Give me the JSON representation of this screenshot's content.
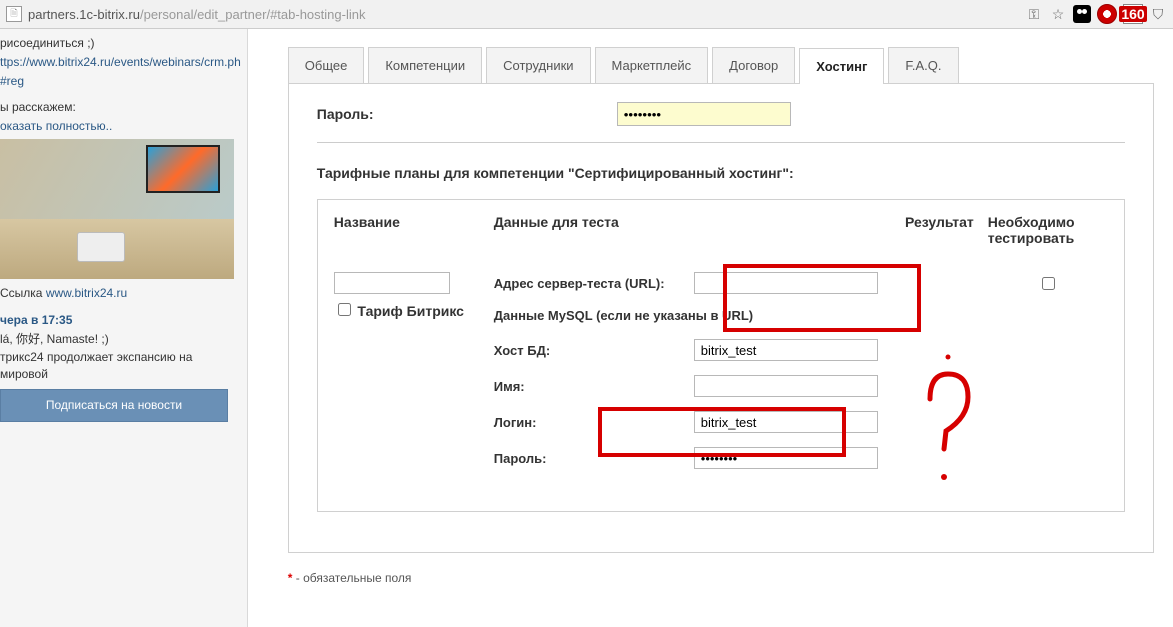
{
  "url": {
    "host": "partners.1c-bitrix.ru",
    "path": "/personal/edit_partner/#tab-hosting-link"
  },
  "ext_badge": "160",
  "sidebar": {
    "line0": "рисоединиться ;)",
    "link1": "ttps://www.bitrix24.ru/events/webinars/crm.ph",
    "line2": "#reg",
    "line3": "ы расскажем:",
    "line4": "оказать полностью..",
    "link_lbl": "Ссылка",
    "link_url": "www.bitrix24.ru",
    "time": "чера в 17:35",
    "greet": "lá, 你好, Namaste! ;)",
    "expand": "трикс24 продолжает экспансию на мировой",
    "subscribe": "Подписаться на новости"
  },
  "tabs": [
    "Общее",
    "Компетенции",
    "Сотрудники",
    "Маркетплейс",
    "Договор",
    "Хостинг",
    "F.A.Q."
  ],
  "active_tab": 5,
  "top_row": {
    "label": "Пароль:",
    "value": "••••••••"
  },
  "section": "Тарифные планы для компетенции \"Сертифицированный хостинг\":",
  "cols": {
    "c1": "Название",
    "c2": "Данные для теста",
    "c3": "Результат",
    "c4": "Необходимо тестировать"
  },
  "tariff": {
    "checkbox_label": "Тариф Битрикс",
    "name_value": ""
  },
  "fields": {
    "url": {
      "label": "Адрес сервер-теста (URL):",
      "value": ""
    },
    "mysql_title": "Данные MySQL (если не указаны в URL)",
    "host": {
      "label": "Хост БД:",
      "value": "bitrix_test"
    },
    "name": {
      "label": "Имя:",
      "value": ""
    },
    "login": {
      "label": "Логин:",
      "value": "bitrix_test"
    },
    "pass": {
      "label": "Пароль:",
      "value": "••••••••"
    }
  },
  "required": "- обязательные поля",
  "required_mark": "*"
}
